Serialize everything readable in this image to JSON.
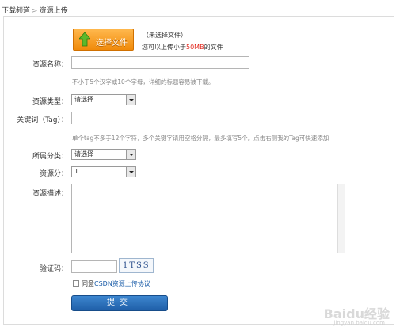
{
  "breadcrumb": {
    "section": "下载频道",
    "separator": ">",
    "current": "资源上传"
  },
  "upload": {
    "button_label": "选择文件",
    "status": "（未选择文件）",
    "size_prefix": "您可以上传小于",
    "size_limit": "50MB",
    "size_suffix": "的文件"
  },
  "form": {
    "name_label": "资源名称：",
    "name_value": "",
    "name_hint": "不小于5个汉字或10个字母，详细的标题容易被下载。",
    "type_label": "资源类型：",
    "type_selected": "请选择",
    "keyword_label": "关键词（Tag）：",
    "keyword_value": "",
    "keyword_hint": "单个tag不多于12个字符，多个关键字请用空格分隔，最多填写5个。点击右侧我的Tag可快速添加",
    "category_label": "所属分类：",
    "category_selected": "请选择",
    "score_label": "资源分：",
    "score_selected": "1",
    "desc_label": "资源描述：",
    "desc_value": "",
    "captcha_label": "验证码：",
    "captcha_value": "",
    "captcha_image_text": "1TSS",
    "agree_text": "同意",
    "agree_link": "CSDN资源上传协议",
    "submit_label": "提交"
  },
  "watermark": {
    "brand": "Baidu经验",
    "url": "jingyan.baidu.com"
  },
  "colors": {
    "upload_orange": "#f08a0a",
    "submit_blue": "#2a6db6",
    "limit_red": "#e1261c",
    "link_blue": "#1a5ca8"
  }
}
